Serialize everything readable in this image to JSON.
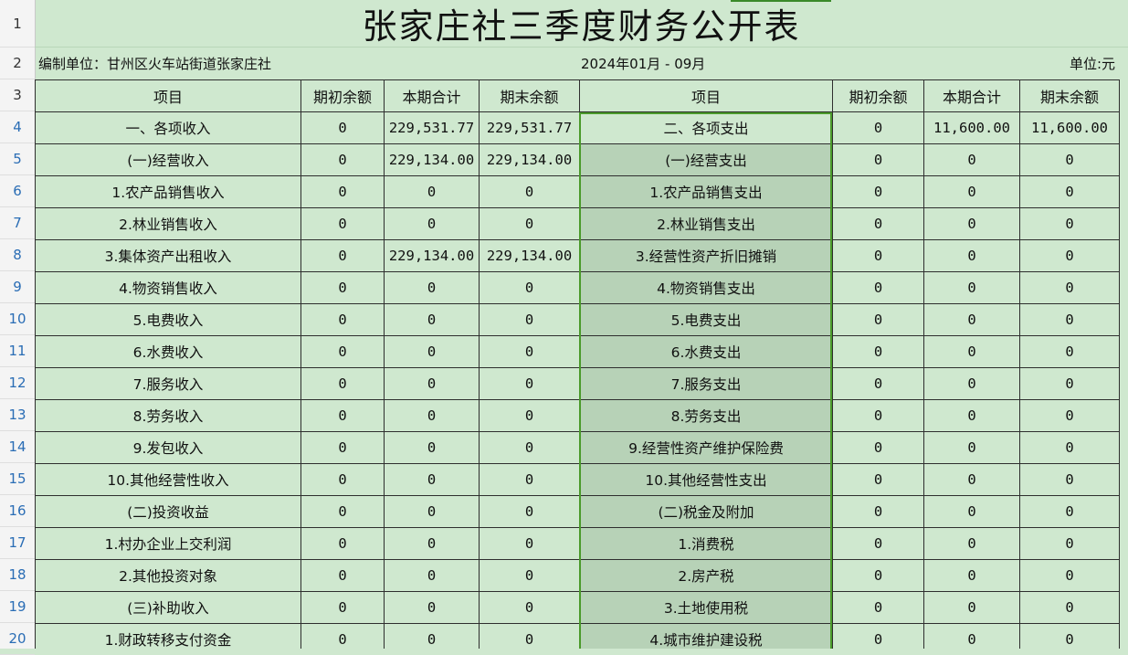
{
  "title": "张家庄社三季度财务公开表",
  "info": {
    "unit_label": "编制单位：甘州区火车站街道张家庄社",
    "period": "2024年01月 - 09月",
    "currency": "单位:元"
  },
  "row_numbers": [
    "1",
    "2",
    "3",
    "4",
    "5",
    "6",
    "7",
    "8",
    "9",
    "10",
    "11",
    "12",
    "13",
    "14",
    "15",
    "16",
    "17",
    "18",
    "19",
    "20"
  ],
  "headers": [
    "项目",
    "期初余额",
    "本期合计",
    "期末余额",
    "项目",
    "期初余额",
    "本期合计",
    "期末余额"
  ],
  "rows": [
    [
      "一、各项收入",
      "0",
      "229,531.77",
      "229,531.77",
      "二、各项支出",
      "0",
      "11,600.00",
      "11,600.00"
    ],
    [
      "(一)经营收入",
      "0",
      "229,134.00",
      "229,134.00",
      "(一)经营支出",
      "0",
      "0",
      "0"
    ],
    [
      "1.农产品销售收入",
      "0",
      "0",
      "0",
      "1.农产品销售支出",
      "0",
      "0",
      "0"
    ],
    [
      "2.林业销售收入",
      "0",
      "0",
      "0",
      "2.林业销售支出",
      "0",
      "0",
      "0"
    ],
    [
      "3.集体资产出租收入",
      "0",
      "229,134.00",
      "229,134.00",
      "3.经营性资产折旧摊销",
      "0",
      "0",
      "0"
    ],
    [
      "4.物资销售收入",
      "0",
      "0",
      "0",
      "4.物资销售支出",
      "0",
      "0",
      "0"
    ],
    [
      "5.电费收入",
      "0",
      "0",
      "0",
      "5.电费支出",
      "0",
      "0",
      "0"
    ],
    [
      "6.水费收入",
      "0",
      "0",
      "0",
      "6.水费支出",
      "0",
      "0",
      "0"
    ],
    [
      "7.服务收入",
      "0",
      "0",
      "0",
      "7.服务支出",
      "0",
      "0",
      "0"
    ],
    [
      "8.劳务收入",
      "0",
      "0",
      "0",
      "8.劳务支出",
      "0",
      "0",
      "0"
    ],
    [
      "9.发包收入",
      "0",
      "0",
      "0",
      "9.经营性资产维护保险费",
      "0",
      "0",
      "0"
    ],
    [
      "10.其他经营性收入",
      "0",
      "0",
      "0",
      "10.其他经营性支出",
      "0",
      "0",
      "0"
    ],
    [
      "(二)投资收益",
      "0",
      "0",
      "0",
      "(二)税金及附加",
      "0",
      "0",
      "0"
    ],
    [
      "1.村办企业上交利润",
      "0",
      "0",
      "0",
      "1.消费税",
      "0",
      "0",
      "0"
    ],
    [
      "2.其他投资对象",
      "0",
      "0",
      "0",
      "2.房产税",
      "0",
      "0",
      "0"
    ],
    [
      "(三)补助收入",
      "0",
      "0",
      "0",
      "3.土地使用税",
      "0",
      "0",
      "0"
    ],
    [
      "1.财政转移支付资金",
      "0",
      "0",
      "0",
      "4.城市维护建设税",
      "0",
      "0",
      "0"
    ]
  ]
}
